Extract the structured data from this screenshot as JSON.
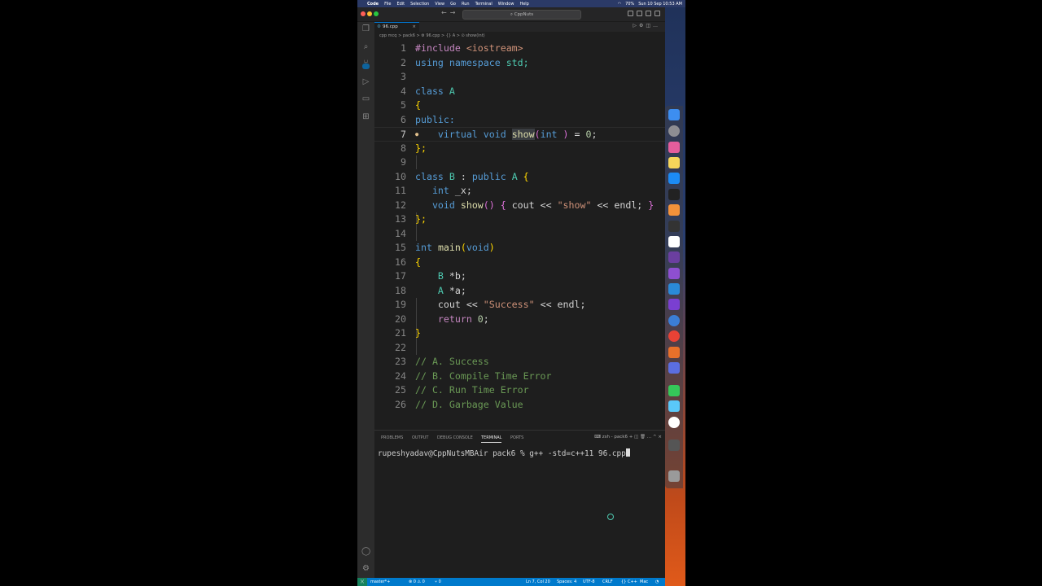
{
  "menubar": {
    "apple": "",
    "items": [
      "Code",
      "File",
      "Edit",
      "Selection",
      "View",
      "Go",
      "Run",
      "Terminal",
      "Window",
      "Help"
    ],
    "battery": "70%",
    "clock": "Sun 10 Sep 10:53 AM"
  },
  "window": {
    "search_text": "CppNuts"
  },
  "editor": {
    "tab_label": "96.cpp",
    "breadcrumb": "cpp mcq  >  pack6  >  ⚙ 96.cpp  >  {} A  >  ⊙ show(int)",
    "lines": [
      {
        "n": "1"
      },
      {
        "n": "2"
      },
      {
        "n": "3"
      },
      {
        "n": "4"
      },
      {
        "n": "5"
      },
      {
        "n": "6"
      },
      {
        "n": "7"
      },
      {
        "n": "8"
      },
      {
        "n": "9"
      },
      {
        "n": "10"
      },
      {
        "n": "11"
      },
      {
        "n": "12"
      },
      {
        "n": "13"
      },
      {
        "n": "14"
      },
      {
        "n": "15"
      },
      {
        "n": "16"
      },
      {
        "n": "17"
      },
      {
        "n": "18"
      },
      {
        "n": "19"
      },
      {
        "n": "20"
      },
      {
        "n": "21"
      },
      {
        "n": "22"
      },
      {
        "n": "23"
      },
      {
        "n": "24"
      },
      {
        "n": "25"
      },
      {
        "n": "26"
      }
    ],
    "code": {
      "l1_kw": "#include",
      "l1_inc": "<iostream>",
      "l2_a": "using",
      "l2_b": "namespace",
      "l2_c": "std;",
      "l4_a": "class",
      "l4_b": "A",
      "l5": "{",
      "l6": "public:",
      "l7_a": "virtual",
      "l7_b": "void",
      "l7_c": "show",
      "l7_d": "(",
      "l7_e": "int",
      "l7_f": ")",
      "l7_g": "=",
      "l7_h": "0",
      "l7_i": ";",
      "l8": "};",
      "l10_a": "class",
      "l10_b": "B",
      "l10_c": ":",
      "l10_d": "public",
      "l10_e": "A",
      "l10_f": "{",
      "l11_a": "int",
      "l11_b": "_x;",
      "l12_a": "void",
      "l12_b": "show",
      "l12_c": "()",
      "l12_d": "{",
      "l12_e": "cout <<",
      "l12_f": "\"show\"",
      "l12_g": "<< endl;",
      "l12_h": "}",
      "l13": "};",
      "l15_a": "int",
      "l15_b": "main",
      "l15_c": "(",
      "l15_d": "void",
      "l15_e": ")",
      "l16": "{",
      "l17_a": "B",
      "l17_b": "*b;",
      "l18_a": "A",
      "l18_b": "*a;",
      "l19_a": "cout <<",
      "l19_b": "\"Success\"",
      "l19_c": "<< endl;",
      "l20_a": "return",
      "l20_b": "0",
      "l20_c": ";",
      "l21": "}",
      "l23": "// A. Success",
      "l24": "// B. Compile Time Error",
      "l25": "// C. Run Time Error",
      "l26": "// D. Garbage Value"
    }
  },
  "panel": {
    "tabs": [
      "PROBLEMS",
      "OUTPUT",
      "DEBUG CONSOLE",
      "TERMINAL",
      "PORTS"
    ],
    "active_tab": "TERMINAL",
    "shell_label": "zsh - pack6",
    "terminal_line": "rupeshyadav@CppNutsMBAir pack6 % g++ -std=c++11 96.cpp"
  },
  "status": {
    "branch": "master*+",
    "problems": "⊗ 0 ⚠ 0",
    "ports": "⑂ 0",
    "position": "Ln 7, Col 20",
    "spaces": "Spaces: 4",
    "encoding": "UTF-8",
    "eol": "CRLF",
    "language": "{} C++",
    "platform": "Mac"
  },
  "colors": {
    "accent": "#007acc",
    "editor_bg": "#1e1e1e",
    "keyword": "#569cd6",
    "comment": "#6a9955",
    "string": "#ce9178"
  }
}
